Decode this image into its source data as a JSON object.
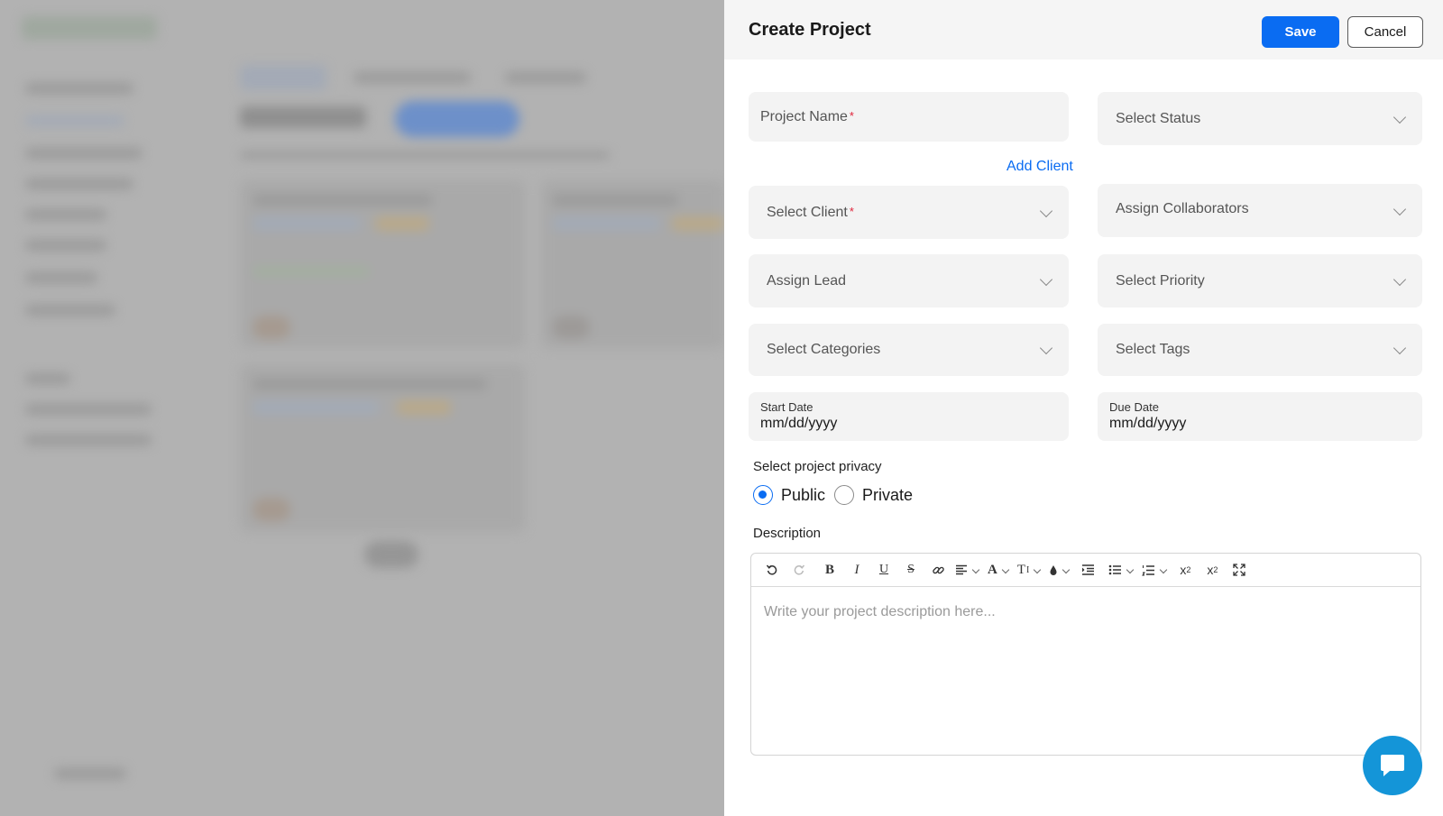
{
  "drawer": {
    "title": "Create Project",
    "save_label": "Save",
    "cancel_label": "Cancel"
  },
  "form": {
    "project_name": {
      "label": "Project Name",
      "required_mark": "*"
    },
    "status": {
      "label": "Select Status"
    },
    "add_client_link": "Add Client",
    "client": {
      "label": "Select Client",
      "required_mark": "*"
    },
    "collaborators": {
      "label": "Assign Collaborators"
    },
    "lead": {
      "label": "Assign Lead"
    },
    "priority": {
      "label": "Select Priority"
    },
    "categories": {
      "label": "Select Categories"
    },
    "tags": {
      "label": "Select Tags"
    },
    "start_date": {
      "label": "Start Date",
      "value": "mm/dd/yyyy"
    },
    "due_date": {
      "label": "Due Date",
      "value": "mm/dd/yyyy"
    },
    "privacy": {
      "label": "Select project privacy",
      "options": [
        "Public",
        "Private"
      ],
      "selected": "Public"
    },
    "description": {
      "label": "Description",
      "placeholder": "Write your project description here..."
    }
  },
  "toolbar_icons": [
    "undo-icon",
    "redo-icon",
    "bold-icon",
    "italic-icon",
    "underline-icon",
    "strikethrough-icon",
    "link-icon",
    "align-icon",
    "font-color-icon",
    "text-size-icon",
    "highlight-icon",
    "indent-icon",
    "bullet-list-icon",
    "numbered-list-icon",
    "superscript-icon",
    "subscript-icon",
    "fullscreen-icon"
  ],
  "colors": {
    "accent": "#0a6cf2",
    "required": "#e0243a",
    "chat": "#1495d8",
    "field_bg": "#f3f3f3"
  }
}
